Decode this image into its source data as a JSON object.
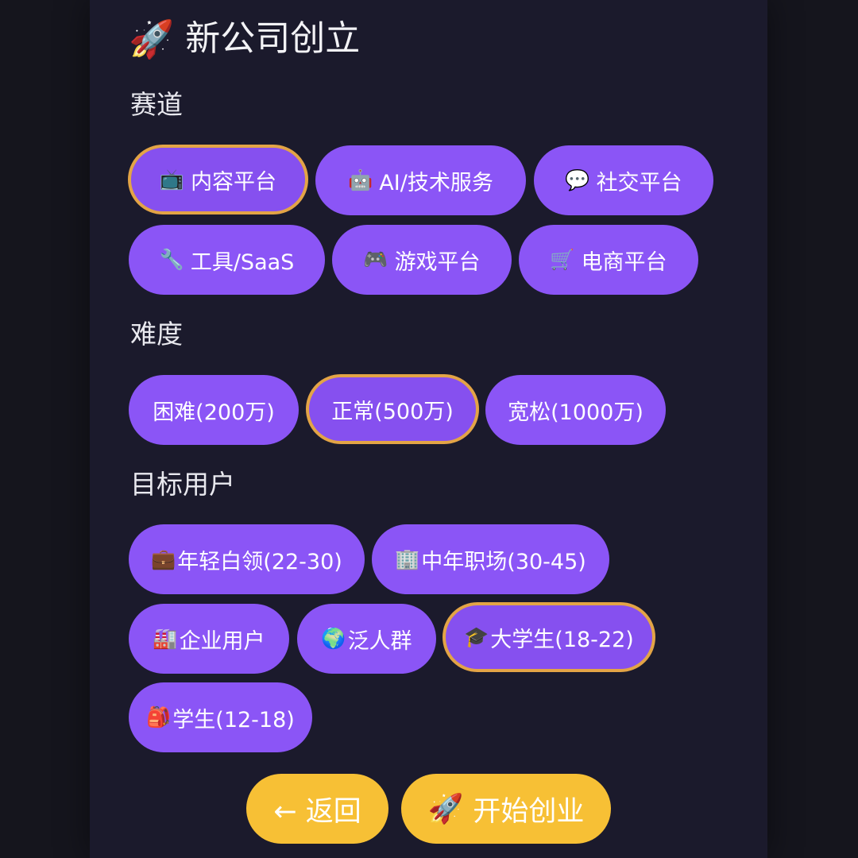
{
  "header": {
    "icon": "rocket-icon",
    "icon_glyph": "🚀",
    "title": "新公司创立"
  },
  "track": {
    "label": "赛道",
    "options": [
      {
        "icon": "tv-icon",
        "glyph": "📺",
        "label": "内容平台",
        "selected": true
      },
      {
        "icon": "robot-icon",
        "glyph": "🤖",
        "label": "AI/技术服务",
        "selected": false
      },
      {
        "icon": "speech-bubble-icon",
        "glyph": "💬",
        "label": "社交平台",
        "selected": false
      },
      {
        "icon": "wrench-icon",
        "glyph": "🔧",
        "label": "工具/SaaS",
        "selected": false
      },
      {
        "icon": "gamepad-icon",
        "glyph": "🎮",
        "label": "游戏平台",
        "selected": false
      },
      {
        "icon": "shopping-cart-icon",
        "glyph": "🛒",
        "label": "电商平台",
        "selected": false
      }
    ]
  },
  "difficulty": {
    "label": "难度",
    "options": [
      {
        "label": "困难(200万)",
        "selected": false
      },
      {
        "label": "正常(500万)",
        "selected": true
      },
      {
        "label": "宽松(1000万)",
        "selected": false
      }
    ]
  },
  "audience": {
    "label": "目标用户",
    "options": [
      {
        "icon": "briefcase-icon",
        "glyph": "💼",
        "label": "年轻白领(22-30)",
        "selected": false
      },
      {
        "icon": "office-building-icon",
        "glyph": "🏢",
        "label": "中年职场(30-45)",
        "selected": false
      },
      {
        "icon": "factory-icon",
        "glyph": "🏭",
        "label": "企业用户",
        "selected": false
      },
      {
        "icon": "globe-icon",
        "glyph": "🌍",
        "label": "泛人群",
        "selected": false
      },
      {
        "icon": "graduation-cap-icon",
        "glyph": "🎓",
        "label": "大学生(18-22)",
        "selected": true
      },
      {
        "icon": "backpack-icon",
        "glyph": "🎒",
        "label": "学生(12-18)",
        "selected": false
      }
    ]
  },
  "actions": {
    "back": {
      "label": "← 返回"
    },
    "start": {
      "icon": "rocket-icon",
      "glyph": "🚀",
      "label": "开始创业"
    }
  },
  "colors": {
    "background": "#15151d",
    "panel": "#1b1a2c",
    "chip": "#8b55f6",
    "selected_border": "#e3a446",
    "button": "#f7c035"
  }
}
